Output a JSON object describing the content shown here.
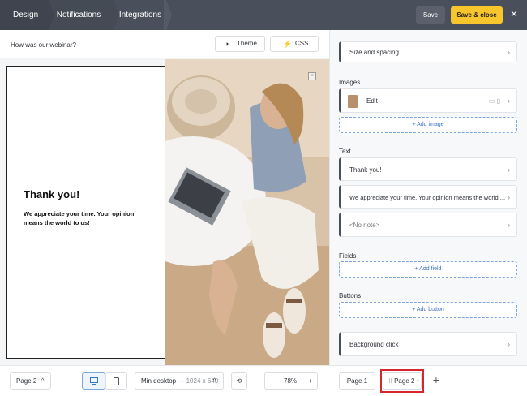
{
  "topbar": {
    "tabs": [
      {
        "label": "Design"
      },
      {
        "label": "Notifications"
      },
      {
        "label": "Integrations"
      }
    ],
    "save_label": "Save",
    "save_close_label": "Save & close",
    "close_glyph": "✕"
  },
  "editor": {
    "form_title": "How was our webinar?",
    "theme_label": "Theme",
    "css_label": "CSS",
    "popup": {
      "heading": "Thank you!",
      "body": "We appreciate your time. Your opinion means the world to us!",
      "close_glyph": "×"
    }
  },
  "bottombar": {
    "page_select": "Page 2",
    "chevron": "^",
    "size_label": "Min desktop",
    "size_value": "— 1024 x 640",
    "zoom_minus": "−",
    "zoom_value": "78%",
    "zoom_plus": "+",
    "pages": [
      {
        "label": "Page 1"
      },
      {
        "label": "Page 2"
      }
    ],
    "add_page": "+"
  },
  "panel": {
    "size_spacing": "Size and spacing",
    "images_header": "Images",
    "image_item": "Edit",
    "add_image": "+ Add image",
    "text_header": "Text",
    "text_items": [
      {
        "label": "Thank you!"
      },
      {
        "label": "We appreciate your time. Your opinion means the world ..."
      },
      {
        "label": "<No note>"
      }
    ],
    "fields_header": "Fields",
    "add_field": "+ Add field",
    "buttons_header": "Buttons",
    "add_button": "+ Add button",
    "background_click": "Background click",
    "arrow": "›"
  },
  "colors": {
    "topbar": "#4a505b",
    "accent": "#f7c52c",
    "highlight": "#d7262d",
    "link": "#3a73c2"
  }
}
